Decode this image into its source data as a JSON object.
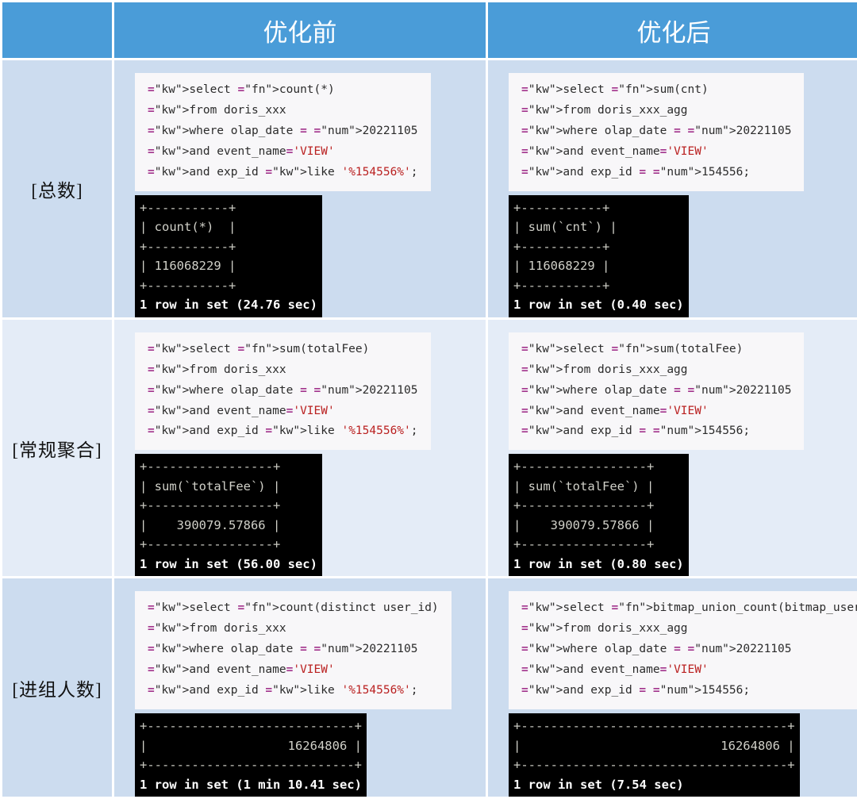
{
  "header": {
    "corner_label": "",
    "before_label": "优化前",
    "after_label": "优化后",
    "header_bg": "#4a9cd8",
    "header_text_color": "#ffffff"
  },
  "palette": {
    "row_dark": "#ccdcef",
    "row_light": "#e4ecf7",
    "sql_bg": "#f8f7f9",
    "terminal_bg": "#000000",
    "terminal_fg": "#d8d8d0",
    "keyword": "#aa22ff",
    "number": "#1a7a52",
    "string": "#ba2121",
    "operator": "#a2338c"
  },
  "rows": [
    {
      "label": "[总数]",
      "before": {
        "sql": "select count(*)\nfrom doris_xxx\nwhere olap_date = 20221105\nand event_name='VIEW'\nand exp_id like '%154556%';",
        "terminal": "+-----------+\n| count(*)  |\n+-----------+\n| 116068229 |\n+-----------+\n1 row in set (24.76 sec)",
        "result_value": "116068229",
        "elapsed": "24.76 sec"
      },
      "after": {
        "sql": "select sum(cnt)\nfrom doris_xxx_agg\nwhere olap_date = 20221105\nand event_name='VIEW'\nand exp_id = 154556;",
        "terminal": "+-----------+\n| sum(`cnt`) |\n+-----------+\n| 116068229 |\n+-----------+\n1 row in set (0.40 sec)",
        "result_value": "116068229",
        "elapsed": "0.40 sec"
      }
    },
    {
      "label": "[常规聚合]",
      "before": {
        "sql": "select sum(totalFee)\nfrom doris_xxx\nwhere olap_date = 20221105\nand event_name='VIEW'\nand exp_id like '%154556%';",
        "terminal": "+-----------------+\n| sum(`totalFee`) |\n+-----------------+\n|    390079.57866 |\n+-----------------+\n1 row in set (56.00 sec)",
        "result_value": "390079.57866",
        "elapsed": "56.00 sec"
      },
      "after": {
        "sql": "select sum(totalFee)\nfrom doris_xxx_agg\nwhere olap_date = 20221105\nand event_name='VIEW'\nand exp_id = 154556;",
        "terminal": "+-----------------+\n| sum(`totalFee`) |\n+-----------------+\n|    390079.57866 |\n+-----------------+\n1 row in set (0.80 sec)",
        "result_value": "390079.57866",
        "elapsed": "0.80 sec"
      }
    },
    {
      "label": "[进组人数]",
      "before": {
        "sql": "select count(distinct user_id)\nfrom doris_xxx\nwhere olap_date = 20221105\nand event_name='VIEW'\nand exp_id like '%154556%';",
        "terminal": "+----------------------------+\n|                   16264806 |\n+----------------------------+\n1 row in set (1 min 10.41 sec)",
        "result_value": "16264806",
        "elapsed": "1 min 10.41 sec"
      },
      "after": {
        "sql": "select bitmap_union_count(bitmap_user_id)\nfrom doris_xxx_agg\nwhere olap_date = 20221105\nand event_name='VIEW'\nand exp_id = 154556;",
        "terminal": "+------------------------------------+\n|                           16264806 |\n+------------------------------------+\n1 row in set (7.54 sec)",
        "result_value": "16264806",
        "elapsed": "7.54 sec"
      }
    }
  ],
  "sql_tokens": {
    "keywords": [
      "select",
      "from",
      "where",
      "and",
      "like"
    ],
    "functions": [
      "count",
      "sum",
      "bitmap_union_count"
    ]
  }
}
